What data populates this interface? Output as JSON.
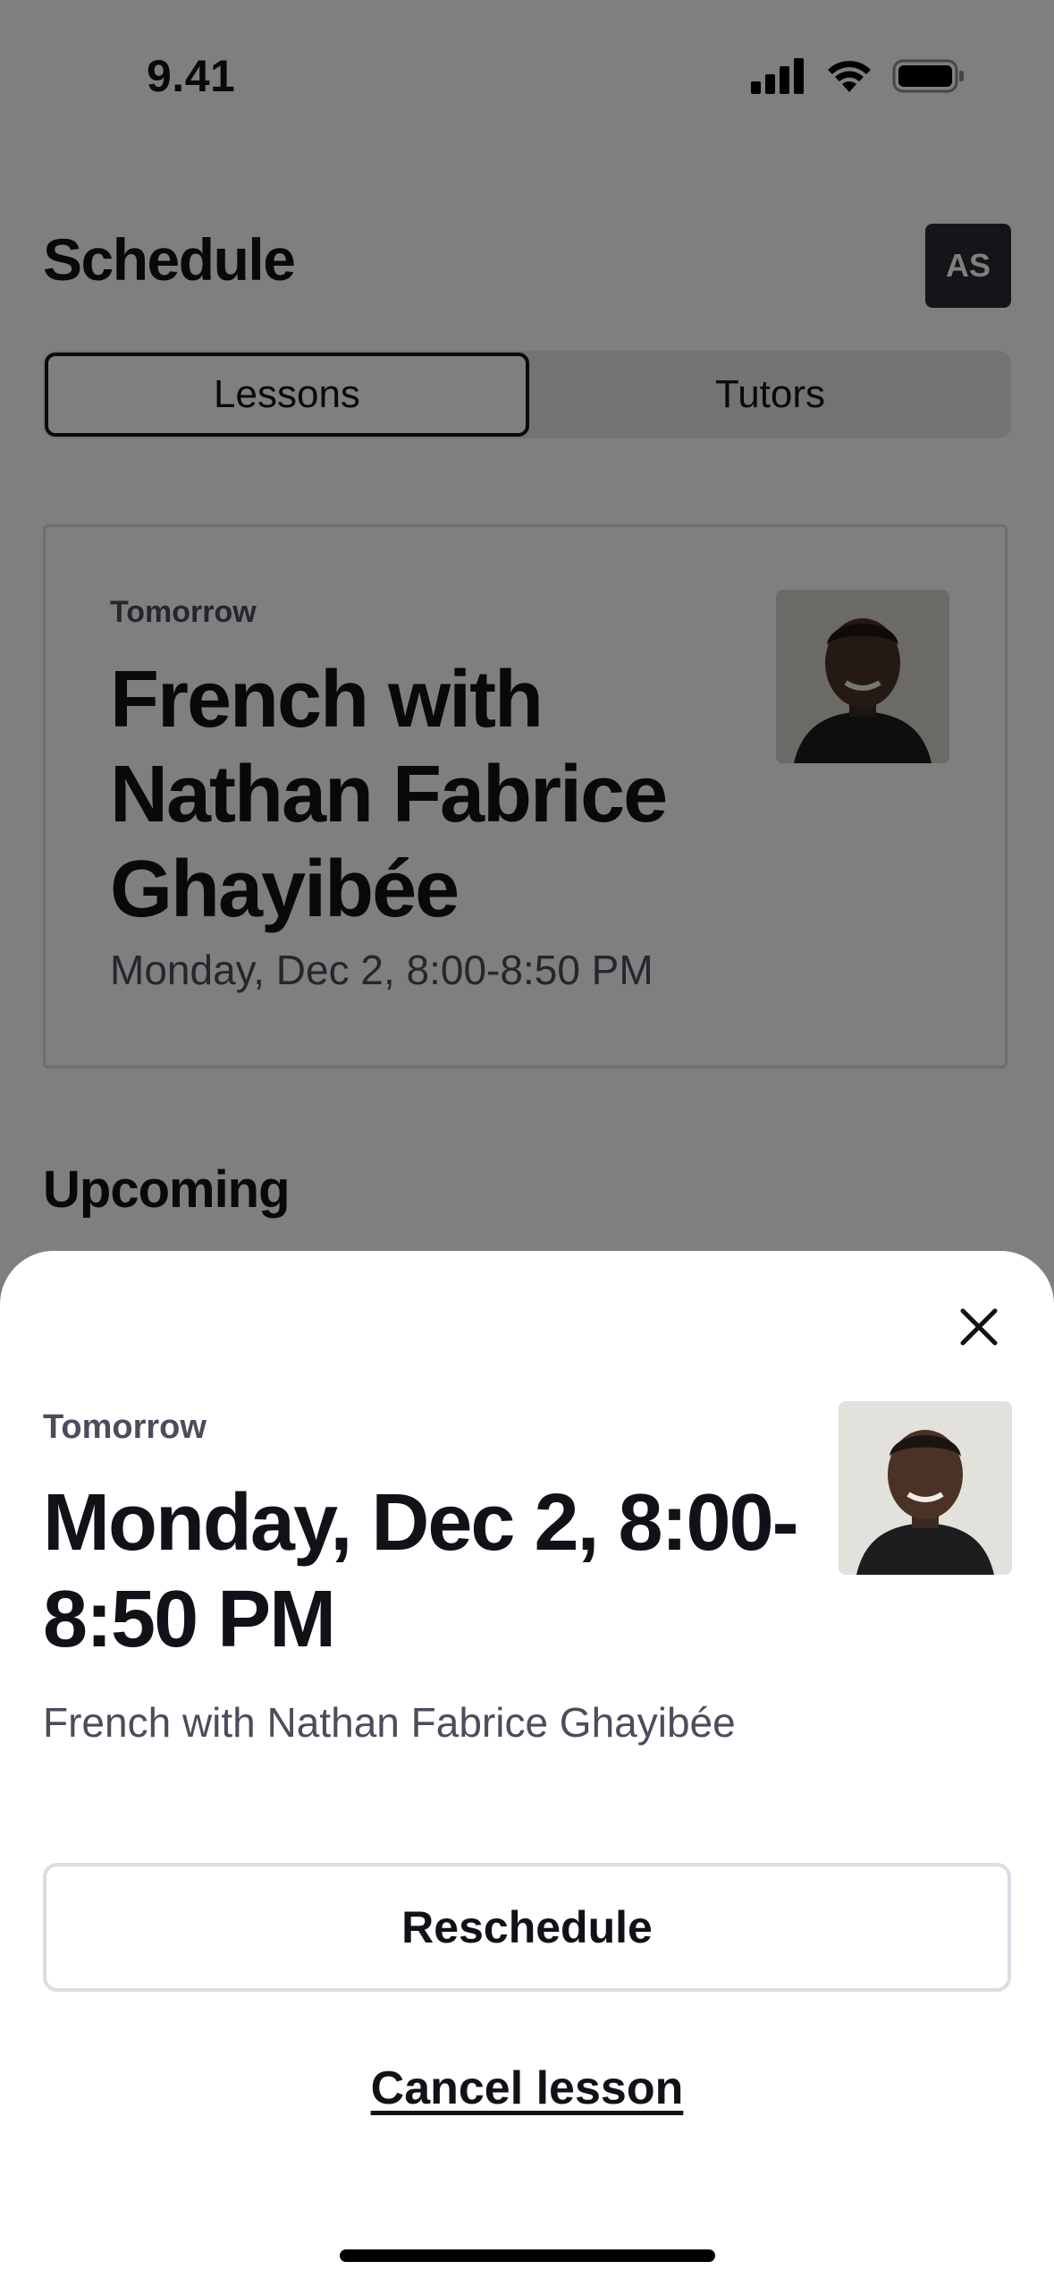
{
  "status_bar": {
    "time": "9.41",
    "icons": [
      "signal-icon",
      "wifi-icon",
      "battery-icon"
    ]
  },
  "header": {
    "title": "Schedule",
    "avatar_initials": "AS"
  },
  "tabs": [
    {
      "label": "Lessons",
      "active": true
    },
    {
      "label": "Tutors",
      "active": false
    }
  ],
  "lesson_card": {
    "when": "Tomorrow",
    "title": "French with Nathan Fabrice Ghayibée",
    "time": "Monday, Dec 2, 8:00-8:50 PM",
    "photo_icon": "tutor-photo"
  },
  "sections": {
    "upcoming": "Upcoming"
  },
  "sheet": {
    "close_icon": "close-icon",
    "when": "Tomorrow",
    "title": "Monday, Dec 2, 8:00-8:50 PM",
    "subtitle": "French with Nathan Fabrice Ghayibée",
    "reschedule_label": "Reschedule",
    "cancel_label": "Cancel lesson"
  },
  "colors": {
    "text_primary": "#121117",
    "text_secondary": "#4d4c5c",
    "border": "#dcdce5",
    "overlay": "rgba(0,0,0,0.5)"
  }
}
